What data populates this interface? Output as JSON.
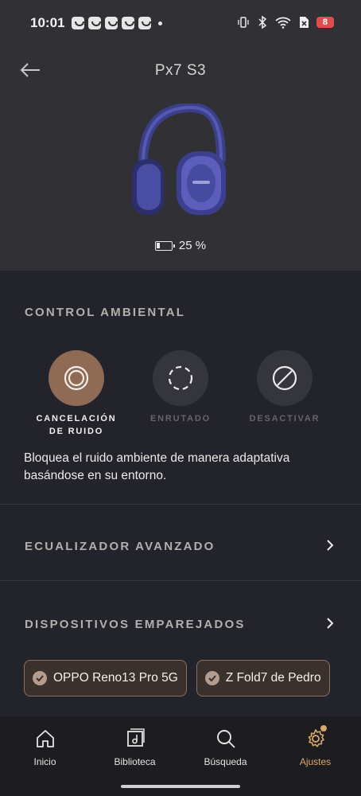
{
  "status_bar": {
    "time": "10:01",
    "battery_level": "8"
  },
  "header": {
    "device_name": "Px7 S3",
    "battery_text": "25 %",
    "battery_fraction": 0.25
  },
  "ambient_control": {
    "title": "CONTROL AMBIENTAL",
    "modes": [
      {
        "label": "CANCELACIÓN DE RUIDO",
        "active": true,
        "icon": "noise-cancel-icon"
      },
      {
        "label": "ENRUTADO",
        "active": false,
        "icon": "transparency-icon"
      },
      {
        "label": "DESACTIVAR",
        "active": false,
        "icon": "off-icon"
      }
    ],
    "description": "Bloquea el ruido ambiente de manera adaptativa basándose en su entorno."
  },
  "equalizer": {
    "title": "ECUALIZADOR AVANZADO"
  },
  "paired_devices": {
    "title": "DISPOSITIVOS EMPAREJADOS",
    "devices": [
      "OPPO Reno13 Pro 5G",
      "Z Fold7 de Pedro"
    ]
  },
  "bottom_nav": {
    "items": [
      {
        "label": "Inicio",
        "icon": "home-icon",
        "active": false
      },
      {
        "label": "Biblioteca",
        "icon": "library-icon",
        "active": false
      },
      {
        "label": "Búsqueda",
        "icon": "search-icon",
        "active": false
      },
      {
        "label": "Ajustes",
        "icon": "settings-icon",
        "active": true
      }
    ]
  },
  "colors": {
    "accent": "#8f6a55",
    "nav_active": "#d9a868",
    "background": "#22232b",
    "header_background": "#303035"
  }
}
